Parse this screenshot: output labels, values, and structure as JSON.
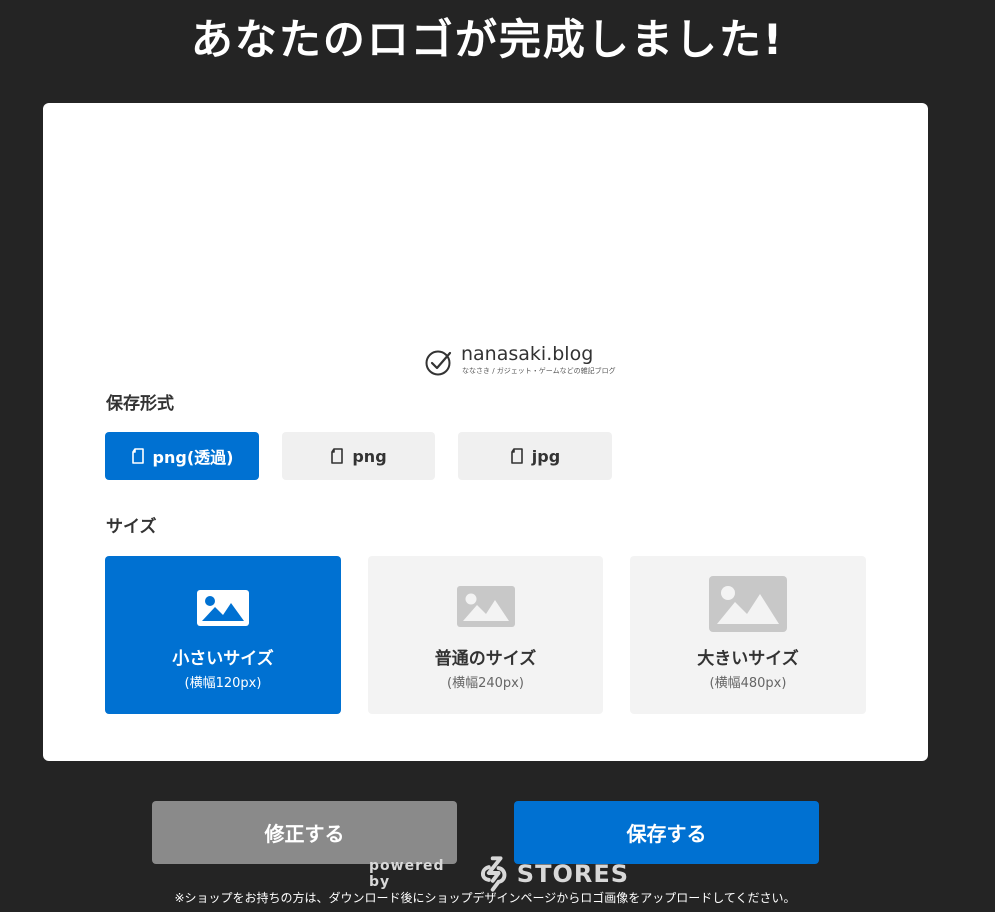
{
  "headline": "あなたのロゴが完成しました!",
  "logo": {
    "name": "nanasaki.blog",
    "tagline": "ななさき / ガジェット・ゲームなどの雑記ブログ",
    "icon": "circle-check-icon"
  },
  "format_section": {
    "label": "保存形式",
    "options": [
      {
        "label": "png(透過)",
        "icon": "file-icon",
        "selected": true
      },
      {
        "label": "png",
        "icon": "file-icon",
        "selected": false
      },
      {
        "label": "jpg",
        "icon": "file-icon",
        "selected": false
      }
    ]
  },
  "size_section": {
    "label": "サイズ",
    "options": [
      {
        "title": "小さいサイズ",
        "sub": "(横幅120px)",
        "icon": "image-icon",
        "selected": true
      },
      {
        "title": "普通のサイズ",
        "sub": "(横幅240px)",
        "icon": "image-icon",
        "selected": false
      },
      {
        "title": "大きいサイズ",
        "sub": "(横幅480px)",
        "icon": "image-icon",
        "selected": false
      }
    ]
  },
  "actions": {
    "edit_label": "修正する",
    "save_label": "保存する"
  },
  "footer": {
    "powered_by": "powered by",
    "brand": "STORES",
    "notice": "※ショップをお持ちの方は、ダウンロード後にショップデザインページからロゴ画像をアップロードしてください。"
  },
  "colors": {
    "background": "#242424",
    "accent": "#0071d2",
    "edit_button": "#8a8a8a"
  }
}
